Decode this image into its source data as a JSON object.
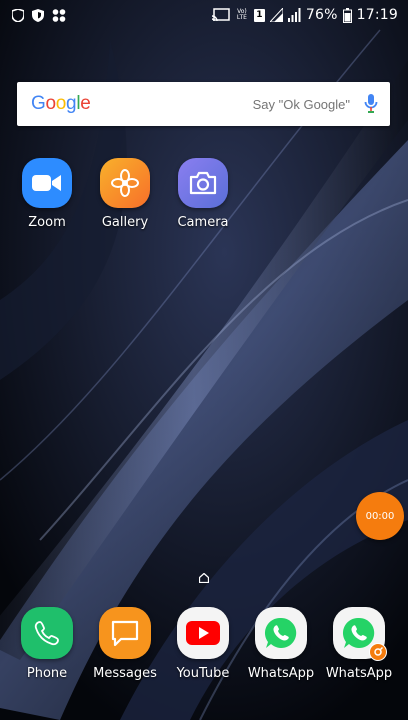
{
  "status_bar": {
    "network_label": "Vo) LTE",
    "sim_slot": "1",
    "battery": "76%",
    "time": "17:19",
    "left_icons": [
      "shield-icon",
      "shield-icon",
      "app-notification-icon"
    ],
    "right_icons": [
      "cast-icon",
      "signal-icon",
      "signal-icon",
      "battery-icon"
    ]
  },
  "search": {
    "logo": [
      "G",
      "o",
      "o",
      "g",
      "l",
      "e"
    ],
    "hint": "Say \"Ok Google\"",
    "mic_icon": "mic-icon"
  },
  "apps": [
    {
      "label": "Zoom",
      "icon": "zoom-video-icon",
      "color": "#2D8CFF"
    },
    {
      "label": "Gallery",
      "icon": "gallery-flower-icon",
      "color": "#F78F1E"
    },
    {
      "label": "Camera",
      "icon": "camera-icon",
      "color": "#7B7BE0"
    }
  ],
  "recorder": {
    "time": "00:00",
    "color": "#F57C0E"
  },
  "dock": [
    {
      "label": "Phone",
      "icon": "phone-icon",
      "color": "#1FBF6B"
    },
    {
      "label": "Messages",
      "icon": "message-icon",
      "color": "#F7941D"
    },
    {
      "label": "YouTube",
      "icon": "youtube-icon",
      "color": "#FF0000"
    },
    {
      "label": "WhatsApp",
      "icon": "whatsapp-icon",
      "color": "#25D366"
    },
    {
      "label": "WhatsApp",
      "icon": "whatsapp-icon",
      "color": "#25D366"
    }
  ]
}
